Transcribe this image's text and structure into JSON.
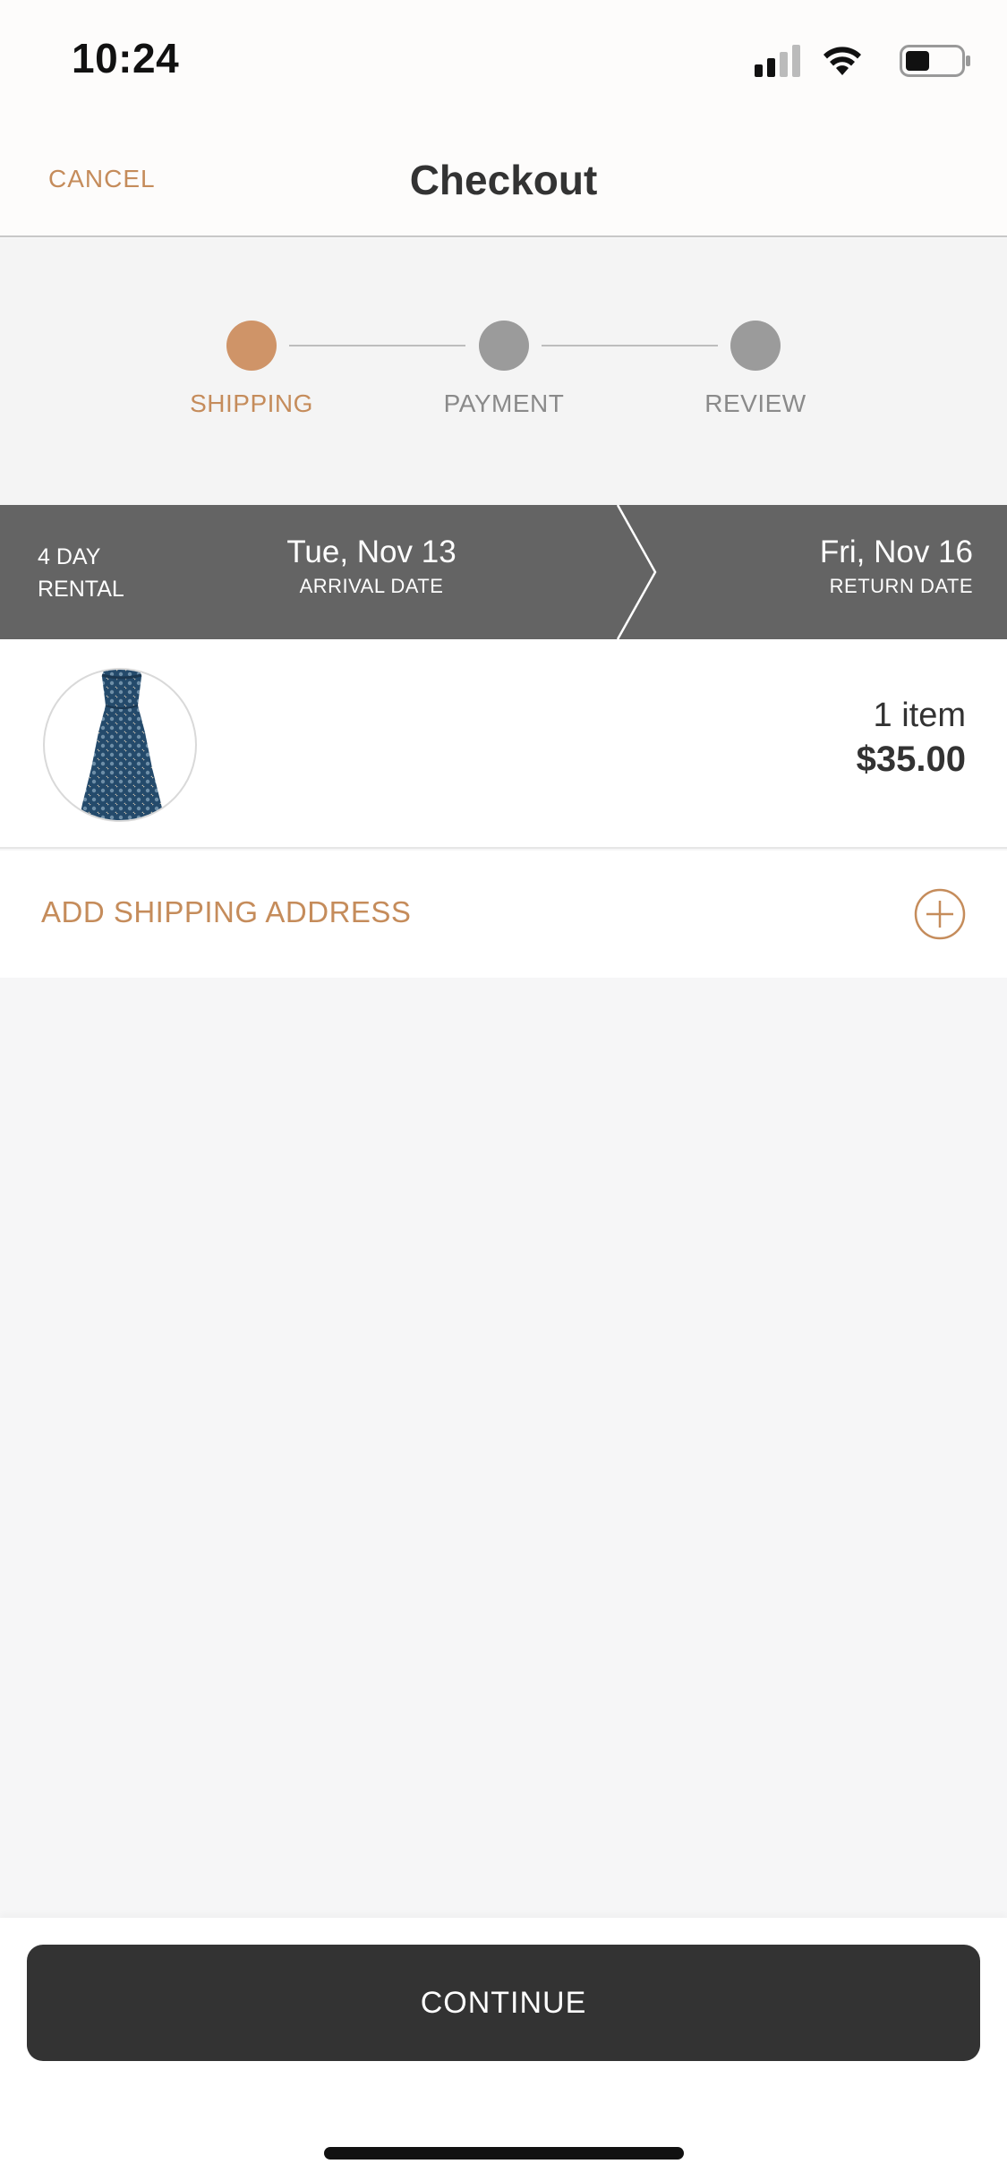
{
  "status_bar": {
    "time": "10:24"
  },
  "nav": {
    "cancel_label": "CANCEL",
    "title": "Checkout"
  },
  "stepper": {
    "steps": [
      {
        "label": "SHIPPING",
        "state": "active"
      },
      {
        "label": "PAYMENT",
        "state": "inactive"
      },
      {
        "label": "REVIEW",
        "state": "inactive"
      }
    ]
  },
  "rental": {
    "length_line1": "4 DAY",
    "length_line2": "RENTAL",
    "arrival_date": "Tue, Nov 13",
    "arrival_label": "ARRIVAL DATE",
    "return_date": "Fri, Nov 16",
    "return_label": "RETURN DATE"
  },
  "cart": {
    "item_count": "1 item",
    "total": "$35.00",
    "product_icon": "dress-thumbnail"
  },
  "address": {
    "add_label": "ADD SHIPPING ADDRESS",
    "icon": "plus-circle-icon"
  },
  "footer": {
    "continue_label": "CONTINUE"
  },
  "colors": {
    "accent": "#c58c5b",
    "active_step": "#cf9468",
    "inactive_step": "#9b9b9b",
    "banner": "#646464",
    "button": "#333333"
  }
}
